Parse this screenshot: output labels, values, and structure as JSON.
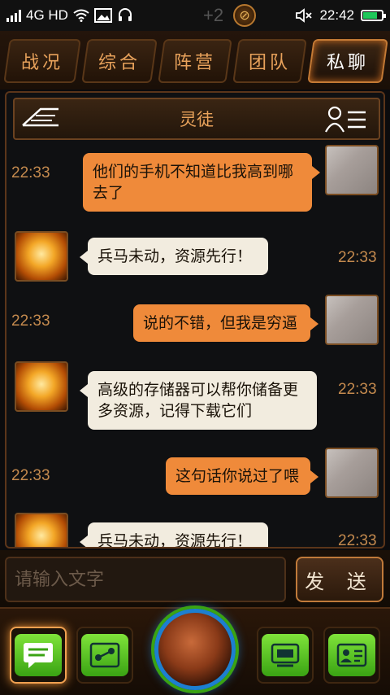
{
  "status_bar": {
    "network": "4G HD",
    "time": "22:42",
    "plus": "+2",
    "coin_symbol": "⊘"
  },
  "tabs": [
    {
      "label": "战况",
      "active": false
    },
    {
      "label": "综合",
      "active": false
    },
    {
      "label": "阵营",
      "active": false
    },
    {
      "label": "团队",
      "active": false
    },
    {
      "label": "私聊",
      "active": true
    }
  ],
  "chat": {
    "title": "灵徒",
    "messages": [
      {
        "direction": "out",
        "time": "22:33",
        "text": "他们的手机不知道比我高到哪去了",
        "avatar": "hand-photo"
      },
      {
        "direction": "in",
        "time": "22:33",
        "text": "兵马未动，资源先行！",
        "avatar": "golden-robot"
      },
      {
        "direction": "out",
        "time": "22:33",
        "text": "说的不错，但我是穷逼",
        "avatar": "hand-photo"
      },
      {
        "direction": "in",
        "time": "22:33",
        "text": "高级的存储器可以帮你储备更多资源，记得下载它们",
        "avatar": "golden-robot"
      },
      {
        "direction": "out",
        "time": "22:33",
        "text": "这句话你说过了喂",
        "avatar": "hand-photo"
      },
      {
        "direction": "in",
        "time": "22:33",
        "text": "兵马未动，资源先行！",
        "avatar": "golden-robot"
      }
    ]
  },
  "input": {
    "placeholder": "请输入文字",
    "send_label": "发 送"
  },
  "bottom_nav": {
    "items": [
      {
        "icon": "chat-icon",
        "active": true
      },
      {
        "icon": "share-icon",
        "active": false
      },
      {
        "icon": "globe-icon",
        "active": false
      },
      {
        "icon": "device-icon",
        "active": false
      },
      {
        "icon": "contact-card-icon",
        "active": false
      }
    ]
  },
  "colors": {
    "accent_orange": "#ef8a3a",
    "tab_text": "#e8a25b",
    "green": "#3aa313",
    "blue": "#1d7fd0"
  }
}
